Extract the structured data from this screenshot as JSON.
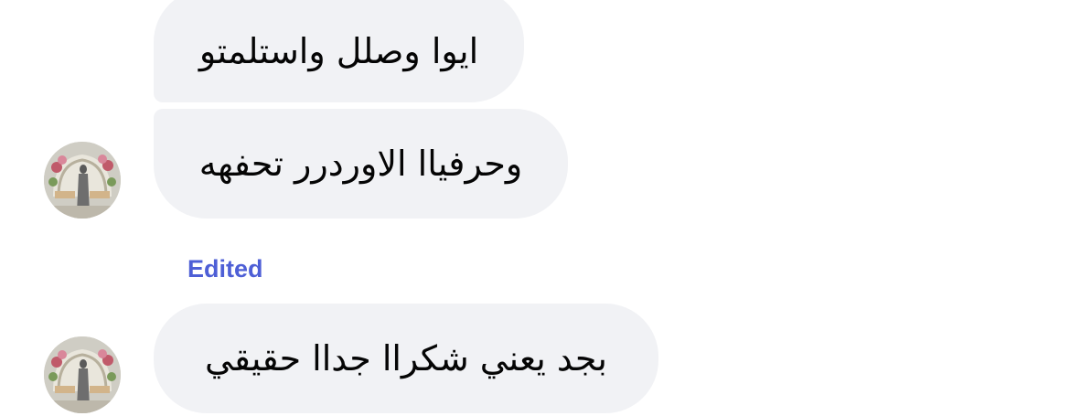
{
  "messages": [
    {
      "text": "ايوا وصلل واستلمتو",
      "has_avatar": false
    },
    {
      "text": "وحرفياا الاوردرر تحفهه",
      "has_avatar": true
    },
    {
      "text": "بجد يعني شكراا جداا حقيقي",
      "has_avatar": true,
      "status": "Edited"
    }
  ],
  "colors": {
    "bubble_bg": "#f1f2f5",
    "edited_label": "#4e5fd6",
    "text": "#050505"
  }
}
